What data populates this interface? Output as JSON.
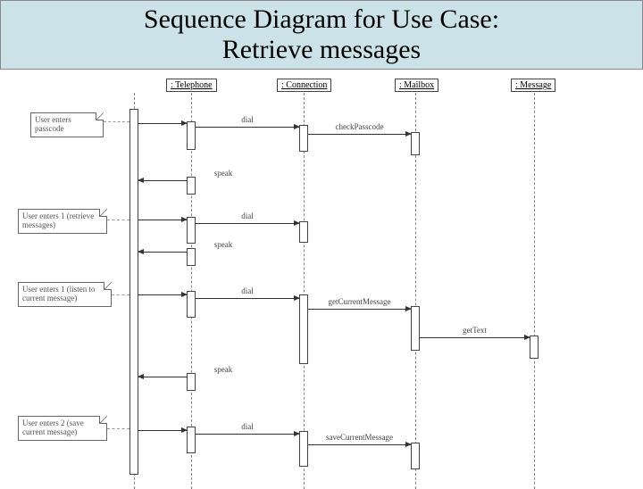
{
  "title_line1": "Sequence Diagram for Use Case:",
  "title_line2": "Retrieve messages",
  "lifelines": {
    "actor": "",
    "telephone": ": Telephone",
    "connection": ": Connection",
    "mailbox": ": Mailbox",
    "message": ": Message"
  },
  "notes": {
    "n1": "User enters passcode",
    "n2": "User enters 1 (retrieve messages)",
    "n3": "User enters 1 (listen to current message)",
    "n4": "User enters 2 (save current message)"
  },
  "messages": {
    "dial1": "dial",
    "checkPasscode": "checkPasscode",
    "speak1": "speak",
    "dial2": "dial",
    "speak2": "speak",
    "dial3": "dial",
    "getCurrentMessage": "getCurrentMessage",
    "getText": "getText",
    "speak3": "speak",
    "dial4": "dial",
    "saveCurrentMessage": "saveCurrentMessage"
  }
}
